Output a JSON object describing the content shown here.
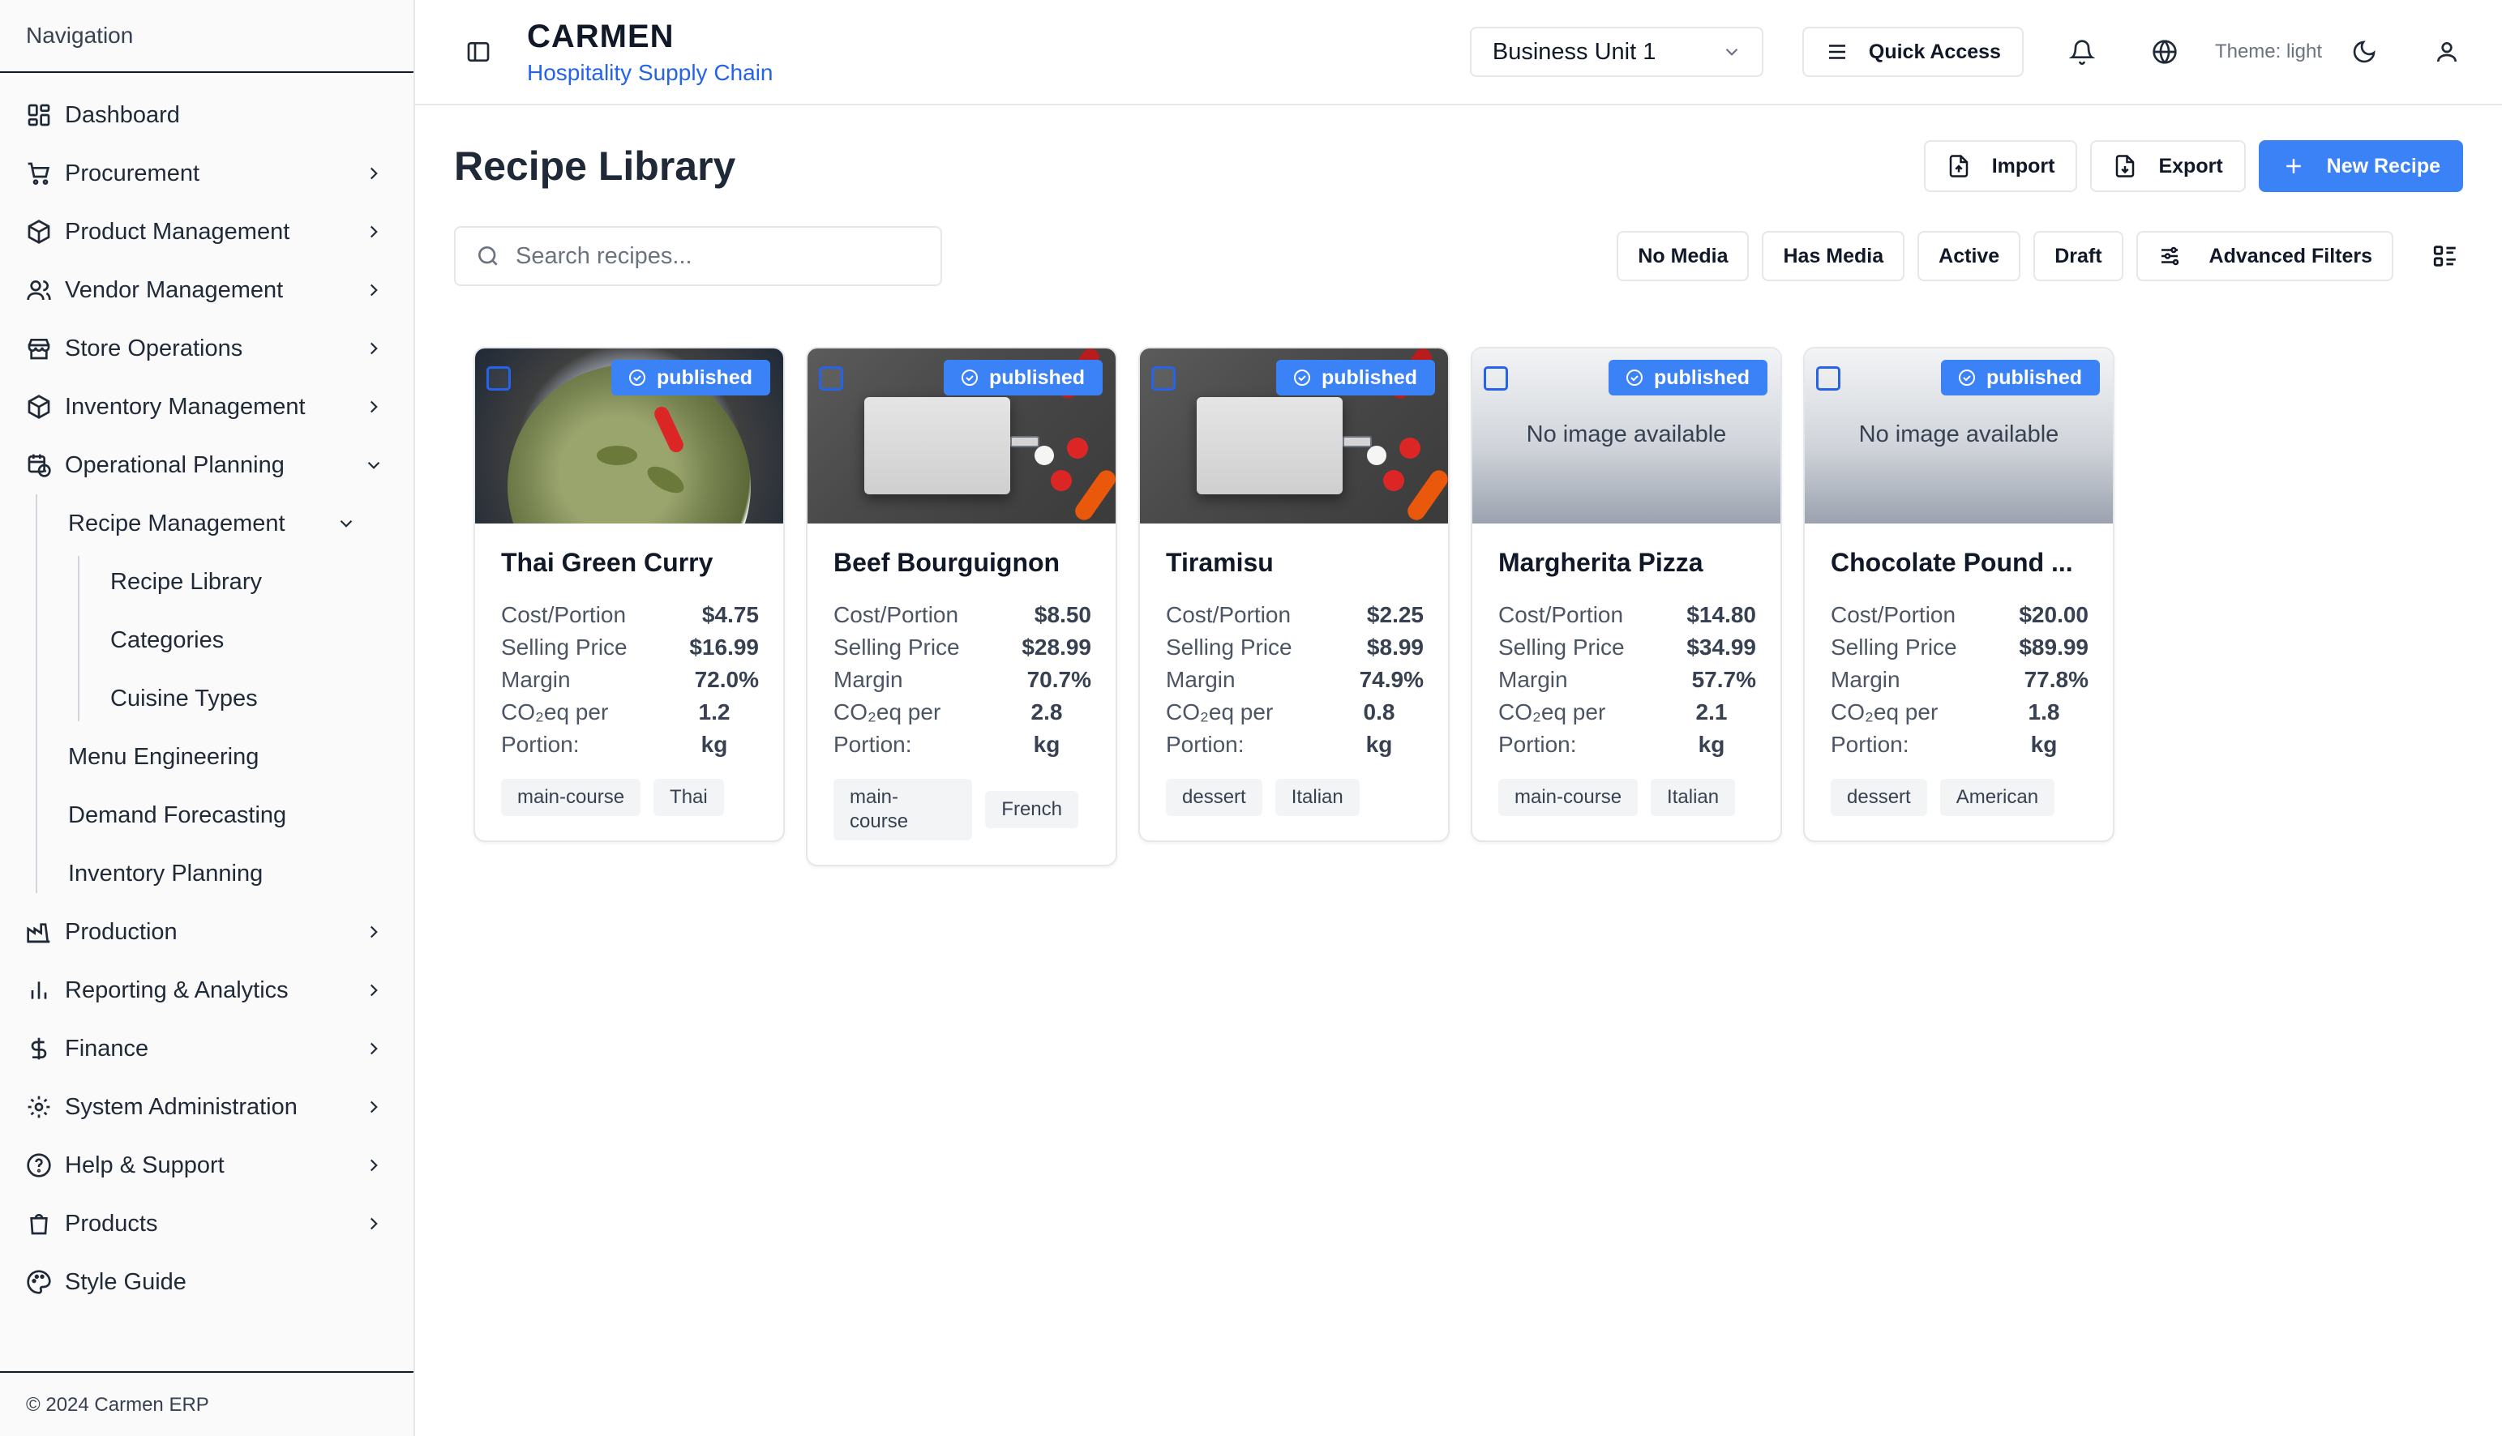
{
  "sidebar": {
    "title": "Navigation",
    "items": [
      {
        "label": "Dashboard"
      },
      {
        "label": "Procurement"
      },
      {
        "label": "Product Management"
      },
      {
        "label": "Vendor Management"
      },
      {
        "label": "Store Operations"
      },
      {
        "label": "Inventory Management"
      },
      {
        "label": "Operational Planning"
      }
    ],
    "operational_planning": {
      "recipe_management": "Recipe Management",
      "recipe_sub": [
        "Recipe Library",
        "Categories",
        "Cuisine Types"
      ],
      "menu_engineering": "Menu Engineering",
      "demand_forecasting": "Demand Forecasting",
      "inventory_planning": "Inventory Planning"
    },
    "items_after": [
      {
        "label": "Production"
      },
      {
        "label": "Reporting & Analytics"
      },
      {
        "label": "Finance"
      },
      {
        "label": "System Administration"
      },
      {
        "label": "Help & Support"
      },
      {
        "label": "Products"
      },
      {
        "label": "Style Guide"
      }
    ],
    "footer": "© 2024 Carmen ERP"
  },
  "header": {
    "brand": "CARMEN",
    "subtitle": "Hospitality Supply Chain",
    "business_unit": "Business Unit 1",
    "quick_access": "Quick Access",
    "theme_label": "Theme: light"
  },
  "page": {
    "title": "Recipe Library",
    "import": "Import",
    "export": "Export",
    "new_recipe": "New Recipe"
  },
  "toolbar": {
    "search_placeholder": "Search recipes...",
    "filters": [
      "No Media",
      "Has Media",
      "Active",
      "Draft"
    ],
    "advanced_filters": "Advanced Filters"
  },
  "labels": {
    "cost": "Cost/Portion",
    "selling": "Selling Price",
    "margin": "Margin",
    "co2_a": "CO₂eq per",
    "co2_b": "Portion:",
    "no_image": "No image available"
  },
  "recipes": [
    {
      "name": "Thai Green Curry",
      "status": "published",
      "cost": "$4.75",
      "selling": "$16.99",
      "margin": "72.0%",
      "co2": "1.2",
      "co2_unit": "kg",
      "tags": [
        "main-course",
        "Thai"
      ]
    },
    {
      "name": "Beef Bourguignon",
      "status": "published",
      "cost": "$8.50",
      "selling": "$28.99",
      "margin": "70.7%",
      "co2": "2.8",
      "co2_unit": "kg",
      "tags": [
        "main-course",
        "French"
      ]
    },
    {
      "name": "Tiramisu",
      "status": "published",
      "cost": "$2.25",
      "selling": "$8.99",
      "margin": "74.9%",
      "co2": "0.8",
      "co2_unit": "kg",
      "tags": [
        "dessert",
        "Italian"
      ]
    },
    {
      "name": "Margherita Pizza",
      "status": "published",
      "cost": "$14.80",
      "selling": "$34.99",
      "margin": "57.7%",
      "co2": "2.1",
      "co2_unit": "kg",
      "tags": [
        "main-course",
        "Italian"
      ]
    },
    {
      "name": "Chocolate Pound ...",
      "status": "published",
      "cost": "$20.00",
      "selling": "$89.99",
      "margin": "77.8%",
      "co2": "1.8",
      "co2_unit": "kg",
      "tags": [
        "dessert",
        "American"
      ]
    }
  ],
  "colors": {
    "accent": "#3b82f6",
    "brand_sub": "#2563eb"
  }
}
